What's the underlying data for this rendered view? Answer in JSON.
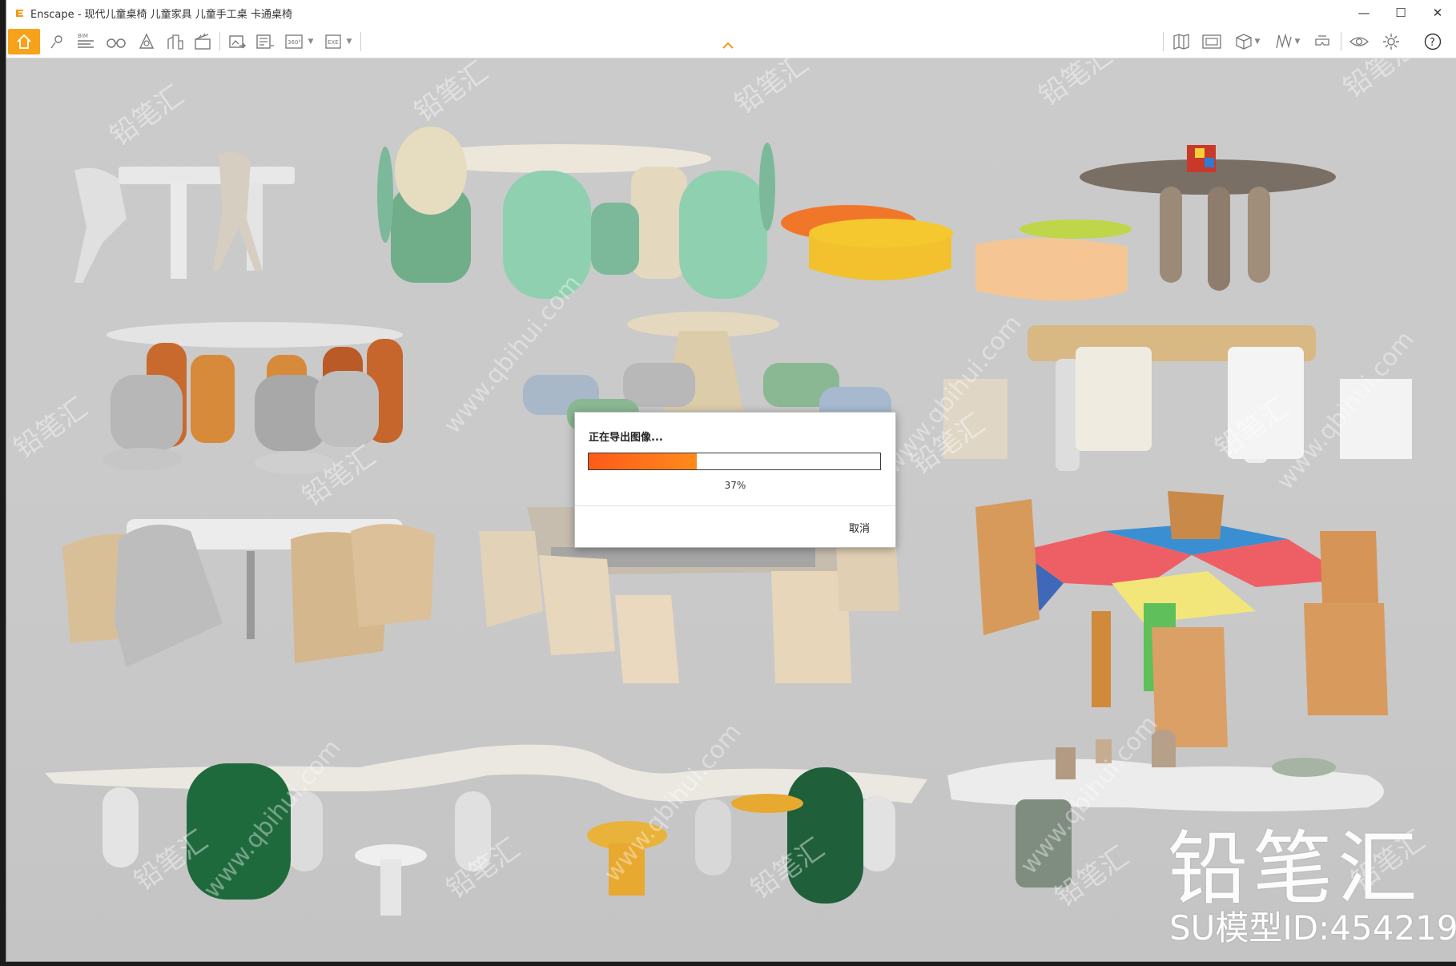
{
  "window": {
    "title": "Enscape - 现代儿童桌椅 儿童家具 儿童手工桌 卡通桌椅",
    "controls": {
      "minimize": "—",
      "maximize": "☐",
      "close": "✕"
    }
  },
  "toolbar": {
    "accent_color": "#f7a21b",
    "buttons": [
      {
        "id": "home",
        "icon": "home-icon",
        "active": true
      },
      {
        "id": "views",
        "icon": "map-pin-icon"
      },
      {
        "id": "bim",
        "icon": "bim-icon",
        "label": "BIM"
      },
      {
        "id": "binoculars",
        "icon": "binoculars-icon"
      },
      {
        "id": "object",
        "icon": "asset-library-icon"
      },
      {
        "id": "atlas",
        "icon": "buildings-icon"
      },
      {
        "id": "visual-settings",
        "icon": "clapperboard-icon"
      },
      {
        "id": "screenshot",
        "icon": "export-image-icon"
      },
      {
        "id": "batch",
        "icon": "batch-render-icon"
      },
      {
        "id": "panorama",
        "icon": "panorama-icon",
        "label": "360°"
      },
      {
        "id": "exe",
        "icon": "export-exe-icon",
        "label": "EXE"
      },
      {
        "id": "map",
        "icon": "map-book-icon"
      },
      {
        "id": "web",
        "icon": "web-standalone-icon"
      },
      {
        "id": "cube",
        "icon": "cube-icon"
      },
      {
        "id": "sketch",
        "icon": "sketch-icon"
      },
      {
        "id": "vr",
        "icon": "vr-headset-icon"
      },
      {
        "id": "eye",
        "icon": "eye-icon"
      },
      {
        "id": "settings",
        "icon": "gear-icon"
      },
      {
        "id": "help",
        "icon": "help-icon",
        "label": "?"
      }
    ]
  },
  "dialog": {
    "title": "正在导出图像...",
    "progress_percent": 37,
    "progress_text": "37%",
    "cancel_label": "取消",
    "bar_color": "#ff6a1a"
  },
  "watermark": {
    "brand": "铅笔汇",
    "model_id": "SU模型ID:454219",
    "tile_text": "铅笔汇",
    "url_text": "www.qbihui.com"
  }
}
